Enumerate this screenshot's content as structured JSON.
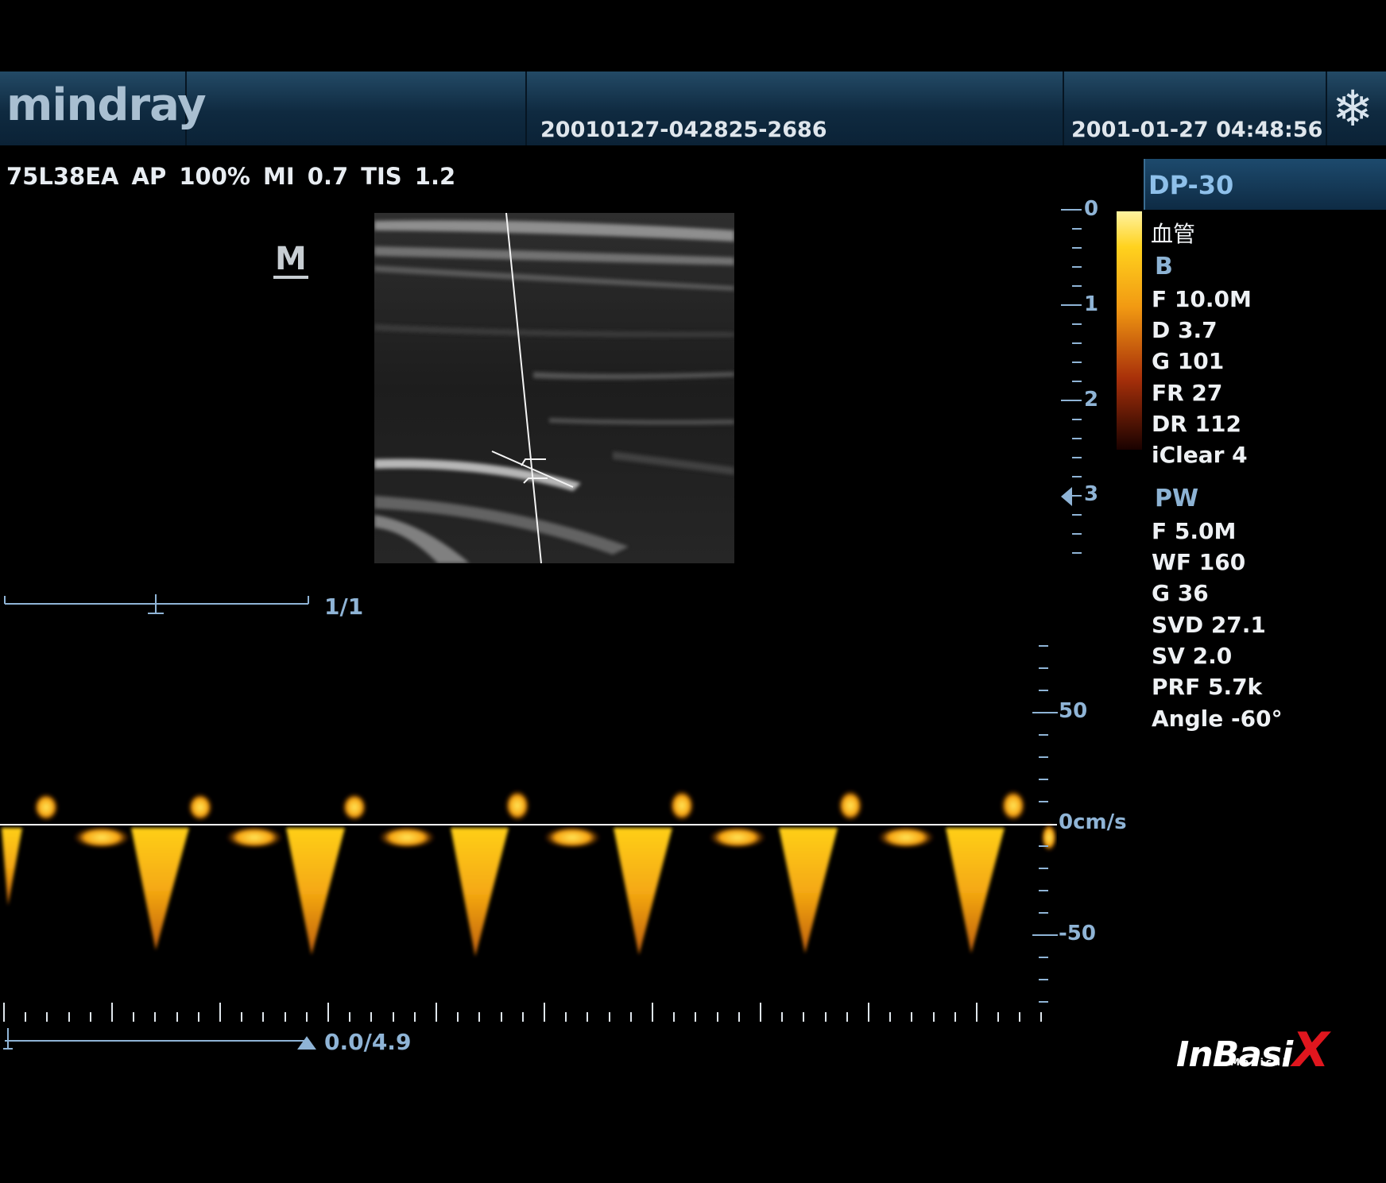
{
  "header": {
    "brand": "mindray",
    "patient_id": "20010127-042825-2686",
    "datetime": "2001-01-27 04:48:56",
    "freeze_icon": "snowflake-icon"
  },
  "probe_info": "75L38EA  AP 100%  MI 0.7  TIS 1.2",
  "orientation_marker": "M",
  "panel": {
    "preset": "DP-30",
    "exam": "血管",
    "b_label": "B",
    "b_params": [
      "F 10.0M",
      "D 3.7",
      "G 101",
      "FR 27",
      "DR 112",
      "iClear 4"
    ],
    "pw_label": "PW",
    "pw_params": [
      "F 5.0M",
      "WF 160",
      "G 36",
      "SVD 27.1",
      "SV 2.0",
      "PRF 5.7k",
      "Angle -60°"
    ]
  },
  "depth_scale": {
    "labels": [
      "0",
      "1",
      "2",
      "3"
    ]
  },
  "image_slider": {
    "label": "1/1"
  },
  "velocity_scale": {
    "labels": [
      "50",
      "0cm/s",
      "-50"
    ]
  },
  "time_slider": {
    "label": "0.0/4.9"
  },
  "colors": {
    "accent": "#8fb4d6",
    "topbar": "#163a56",
    "doppler_hot": "#ffd21e"
  },
  "watermark": {
    "text": "InBasiX",
    "sub": "Medical"
  }
}
